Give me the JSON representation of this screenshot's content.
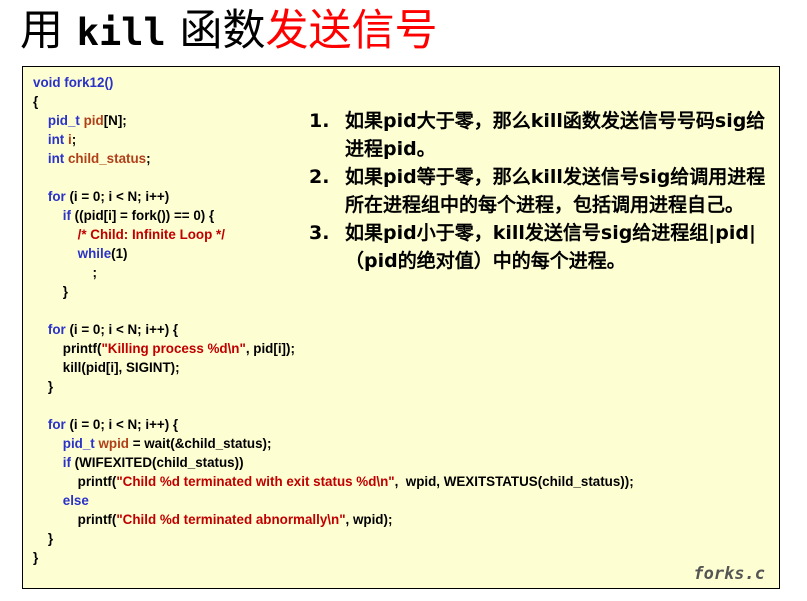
{
  "title": {
    "part1": "用 ",
    "part2": "kill",
    "part3": " 函数",
    "part4": "发送信号"
  },
  "code": {
    "l1_kw": "void ",
    "l1_fn": "fork12()",
    "l2": "{",
    "l3_ty": "pid_t ",
    "l3_var": "pid",
    "l3_rest": "[N];",
    "l4_ty": "int ",
    "l4_var": "i",
    "l4_rest": ";",
    "l5_ty": "int ",
    "l5_var": "child_status",
    "l5_rest": ";",
    "l7_kw": "for ",
    "l7_rest": "(i = 0; i < N; i++)",
    "l8_kw": "if ",
    "l8_rest": "((pid[i] = fork()) == 0) {",
    "l9_cmt": "/* Child: Infinite Loop */",
    "l10_kw": "while",
    "l10_rest": "(1)",
    "l11": ";",
    "l12": "}",
    "l14_kw": "for ",
    "l14_rest": "(i = 0; i < N; i++) {",
    "l15_a": "printf(",
    "l15_str": "\"Killing process %d\\n\"",
    "l15_b": ", pid[i]);",
    "l16": "kill(pid[i], SIGINT);",
    "l17": "}",
    "l19_kw": "for ",
    "l19_rest": "(i = 0; i < N; i++) {",
    "l20_ty": "pid_t ",
    "l20_var": "wpid",
    "l20_rest": " = wait(&child_status);",
    "l21_kw": "if ",
    "l21_rest": "(WIFEXITED(child_status))",
    "l22_a": "printf(",
    "l22_str": "\"Child %d terminated with exit status %d\\n\"",
    "l22_b": ",  wpid, WEXITSTATUS(child_status));",
    "l23_kw": "else",
    "l24_a": "printf(",
    "l24_str": "\"Child %d terminated abnormally\\n\"",
    "l24_b": ", wpid);",
    "l25": "}",
    "l26": "}"
  },
  "notes": [
    {
      "num": "1.",
      "text": "如果pid大于零，那么kill函数发送信号号码sig给进程pid。"
    },
    {
      "num": "2.",
      "text": "如果pid等于零，那么kill发送信号sig给调用进程所在进程组中的每个进程，包括调用进程自己。"
    },
    {
      "num": "3.",
      "text": "如果pid小于零，kill发送信号sig给进程组|pid|（pid的绝对值）中的每个进程。"
    }
  ],
  "filename": "forks.c"
}
